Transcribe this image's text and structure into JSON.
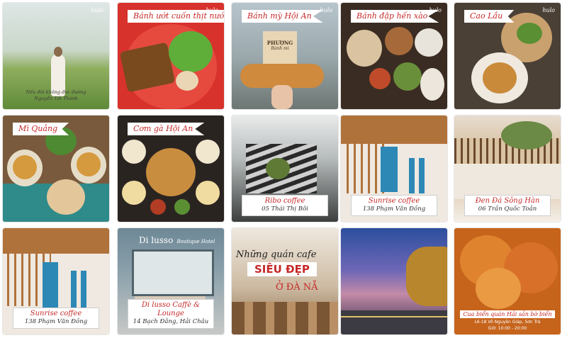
{
  "brand_mark": "hulo",
  "tiles": [
    {
      "caption_line1": "Nếu đời không đọc đường",
      "caption_line2": "Nguyễn Tất Thành"
    },
    {
      "ribbon": "Bánh ướt cuốn thịt nướng"
    },
    {
      "ribbon": "Bánh mỳ Hội An",
      "sign_brand": "PHƯỢNG",
      "sign_sub": "Bánh mì"
    },
    {
      "ribbon": "Bánh đập hến xào"
    },
    {
      "ribbon": "Cao Lầu"
    },
    {
      "ribbon": "Mì Quảng"
    },
    {
      "ribbon": "Cơm gà Hội An"
    },
    {
      "name": "Ribo coffee",
      "address": "05 Thái Thị Bôi"
    },
    {
      "name": "Sunrise coffee",
      "address": "138 Phạm Văn Đồng"
    },
    {
      "name": "Đen Đá Sông Hàn",
      "address": "06 Trần Quốc Toản"
    },
    {
      "name": "Sunrise coffee",
      "address": "138 Phạm Văn Đồng"
    },
    {
      "sign": "Di lusso",
      "sign_sub": "Boutique Hotel",
      "name": "Di lusso Caffè & Lounge",
      "address": "14 Bạch Đằng, Hải Châu"
    },
    {
      "headline1": "Những quán cafe",
      "headline2": "SIÊU ĐẸP",
      "headline3": "Ở ĐÀ NẴ"
    },
    {},
    {
      "name": "Cua biển quán Hải sản bờ biển",
      "address": "L6-18 Võ Nguyên Giáp, Sơn Trà",
      "hours": "Giờ: 10:00 - 20:00"
    }
  ]
}
